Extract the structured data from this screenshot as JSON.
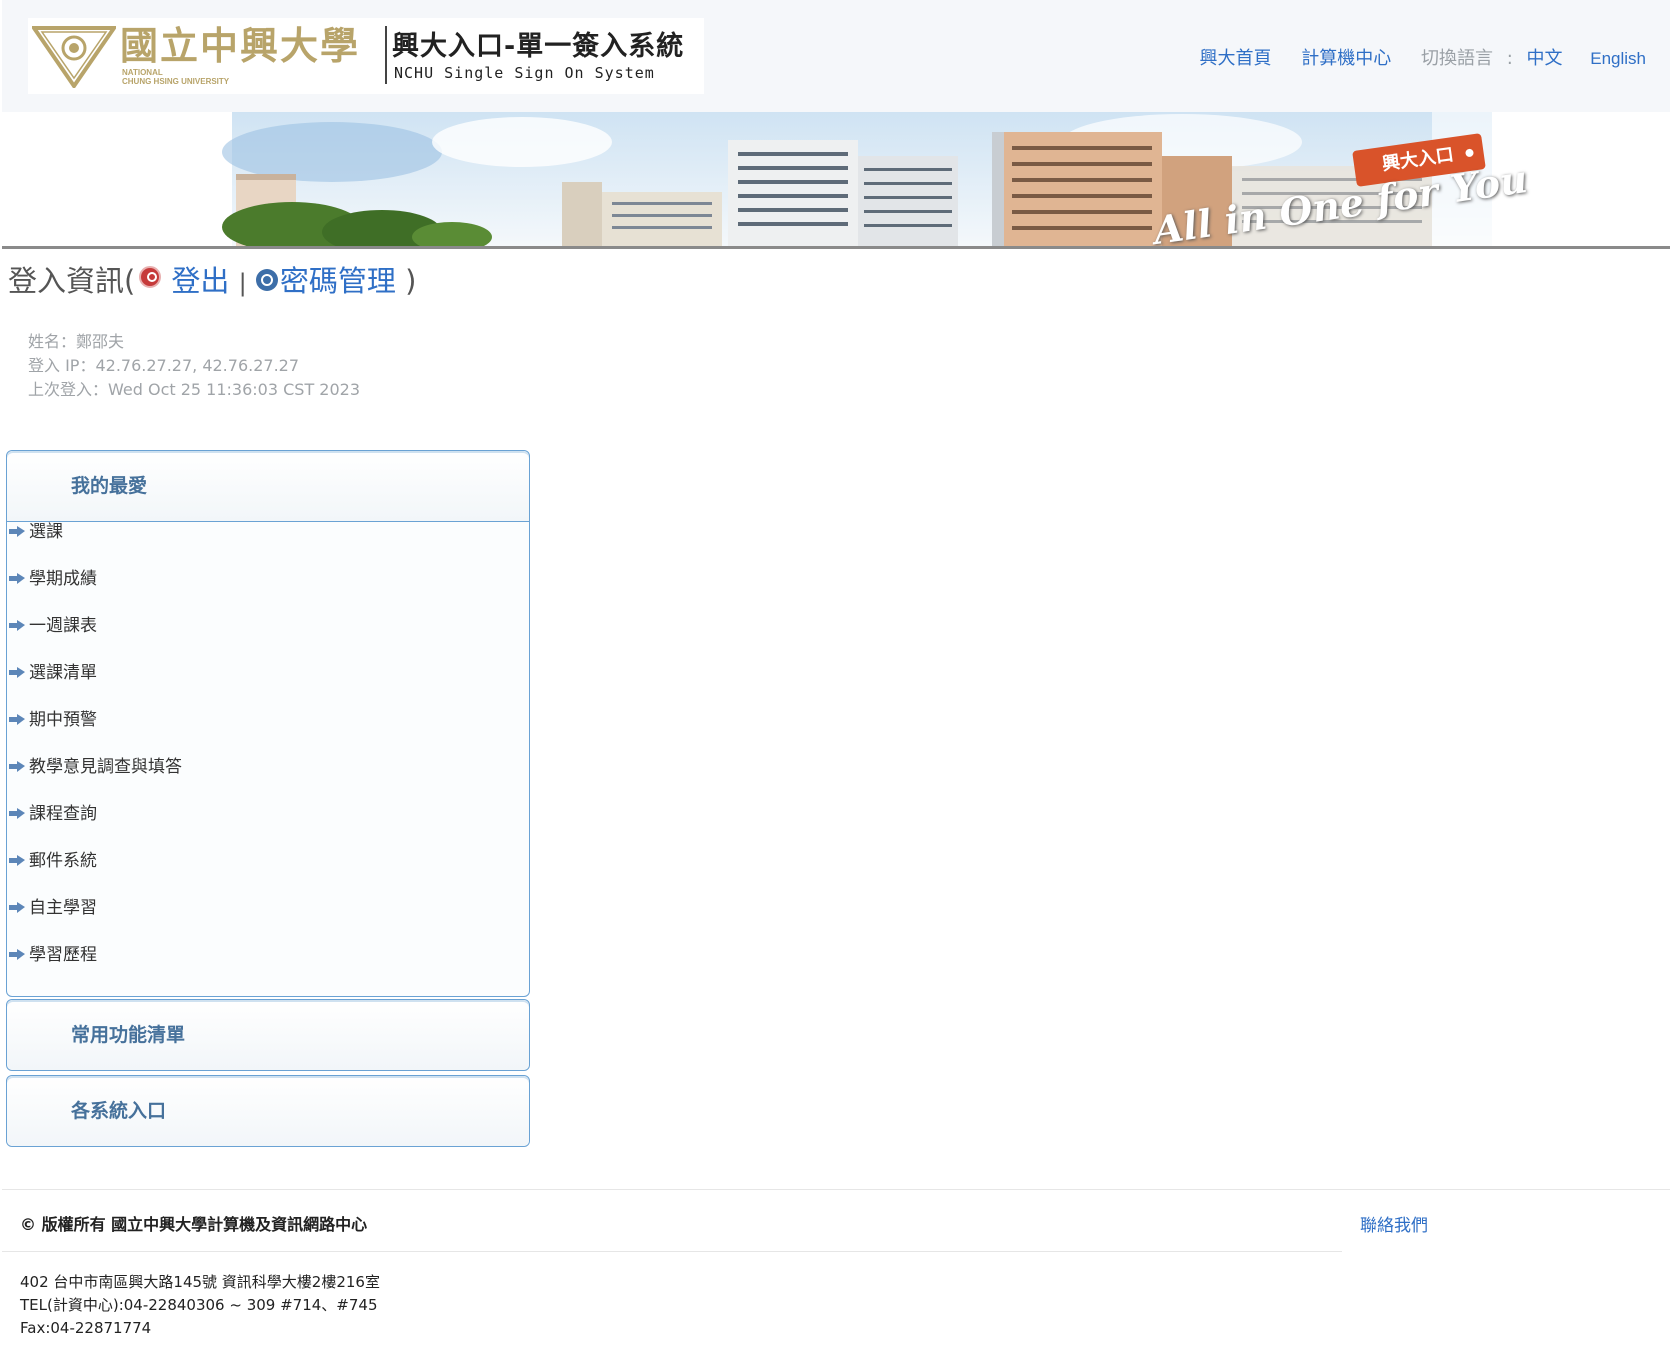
{
  "header": {
    "school_name_cn": "國立中興大學",
    "school_name_en": [
      "NATIONAL",
      "CHUNG HSING UNIVERSITY"
    ],
    "system_title_cn": "興大入口-單一簽入系統",
    "system_title_en": "NCHU Single Sign On System",
    "links": {
      "home": "興大首頁",
      "computer_center": "計算機中心",
      "switch_lang": "切換語言",
      "colon": ":",
      "lang_cn": "中文",
      "lang_en": "English"
    }
  },
  "banner": {
    "tag": "興大入口",
    "slogan": "All in One for You"
  },
  "login": {
    "heading": "登入資訊",
    "open_paren": "(",
    "logout": "登出",
    "separator": "|",
    "password_mgmt": "密碼管理",
    "close_paren": ")",
    "name": "姓名：鄭邵夫",
    "ip": "登入 IP：42.76.27.27, 42.76.27.27",
    "last_login": "上次登入：Wed Oct 25 11:36:03 CST 2023"
  },
  "panels": {
    "favorites": {
      "title": "我的最愛",
      "items": [
        "選課",
        "學期成績",
        "一週課表",
        "選課清單",
        "期中預警",
        "教學意見調查與填答",
        "課程查詢",
        "郵件系統",
        "自主學習",
        "學習歷程"
      ]
    },
    "common": {
      "title": "常用功能清單"
    },
    "systems": {
      "title": "各系統入口"
    }
  },
  "footer": {
    "copyright": "© 版權所有 國立中興大學計算機及資訊網路中心",
    "contact": "聯絡我們",
    "address": "402 台中市南區興大路145號 資訊科學大樓2樓216室",
    "tel": "TEL(計資中心):04-22840306 ~ 309 #714、#745",
    "fax": "Fax:04-22871774"
  },
  "colors": {
    "link": "#2f6fc6",
    "panel_border": "#6aa2d4",
    "panel_title": "#46719b",
    "logo_gold": "#b8a46a",
    "banner_tag": "#d9532a"
  }
}
